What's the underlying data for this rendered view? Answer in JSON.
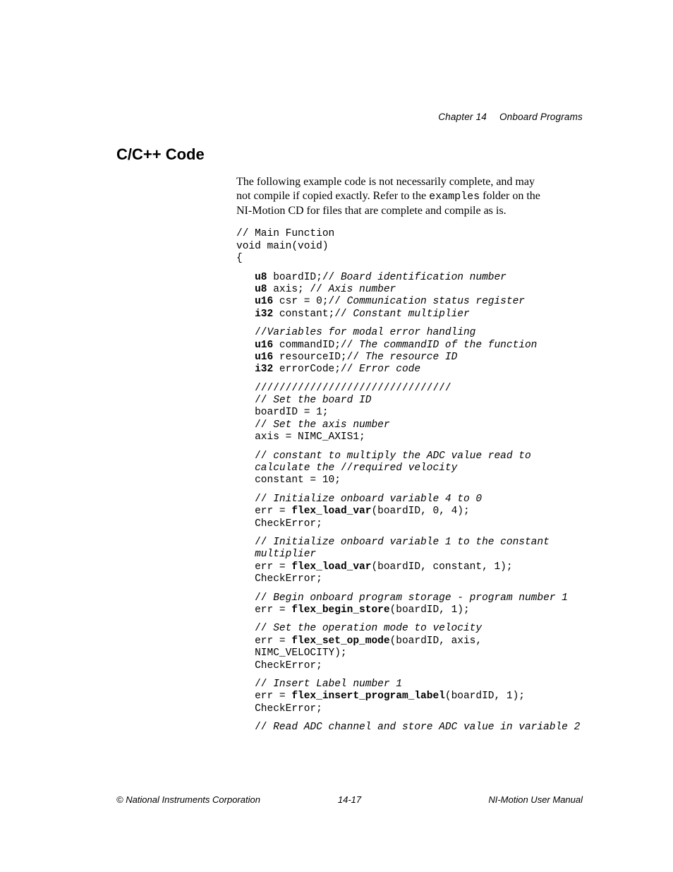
{
  "header": {
    "chapter_label": "Chapter 14",
    "chapter_title": "Onboard Programs"
  },
  "heading": "C/C++ Code",
  "intro": {
    "line1a": "The following example code is not necessarily complete, and may ",
    "line2a": "not compile if copied exactly. Refer to the ",
    "line2_code": "examples",
    "line2b": " folder on the ",
    "line3": "NI-Motion CD for files that are complete and compile as is."
  },
  "code": {
    "p1_l1": "// Main Function",
    "p1_l2": "void main(void)",
    "p1_l3": "{",
    "p2_prefix": "   ",
    "p2_l1_kw": "u8",
    "p2_l1_rest": " boardID;// ",
    "p2_l1_it": "Board identification number",
    "p2_l2_kw": "u8",
    "p2_l2_rest": " axis; // ",
    "p2_l2_it": "Axis number",
    "p2_l3_kw": "u16",
    "p2_l3_rest": " csr = 0;// ",
    "p2_l3_it": "Communication status register",
    "p2_l4_kw": "i32",
    "p2_l4_rest": " constant;// ",
    "p2_l4_it": "Constant multiplier",
    "p3_l1_a": "   //",
    "p3_l1_it": "Variables for modal error handling",
    "p3_l2_kw": "u16",
    "p3_l2_rest": " commandID;// ",
    "p3_l2_it": "The commandID of the function",
    "p3_l3_kw": "u16",
    "p3_l3_rest": " resourceID;// ",
    "p3_l3_it": "The resource ID",
    "p3_l4_kw": "i32",
    "p3_l4_rest": " errorCode;// ",
    "p3_l4_it": "Error code",
    "p4_l1": "   ////////////////////////////////",
    "p4_l2_a": "   // ",
    "p4_l2_it": "Set the board ID",
    "p4_l3": "   boardID = 1;",
    "p4_l4_a": "   // ",
    "p4_l4_it": "Set the axis number",
    "p4_l5": "   axis = NIMC_AXIS1;",
    "p5_l1_a": "   // ",
    "p5_l1_it": "constant to multiply the ADC value read to ",
    "p5_l2_it_a": "calculate the ",
    "p5_l2_mid": "//",
    "p5_l2_it_b": "required velocity",
    "p5_l3": "   constant = 10;",
    "p6_l1_a": "   // ",
    "p6_l1_it": "Initialize onboard variable 4 to 0",
    "p6_l2_a": "   err = ",
    "p6_l2_fn": "flex_load_var",
    "p6_l2_b": "(boardID, 0, 4);",
    "p6_l3": "   CheckError;",
    "p7_l1_a": "   // ",
    "p7_l1_it": "Initialize onboard variable 1 to the constant ",
    "p7_l2_it": "multiplier",
    "p7_l3_a": "   err = ",
    "p7_l3_fn": "flex_load_var",
    "p7_l3_b": "(boardID, constant, 1);",
    "p7_l4": "   CheckError;",
    "p8_l1_a": "   // ",
    "p8_l1_it": "Begin onboard program storage - program number 1",
    "p8_l2_a": "   err = ",
    "p8_l2_fn": "flex_begin_store",
    "p8_l2_b": "(boardID, 1);",
    "p9_l1_a": "   // ",
    "p9_l1_it": "Set the operation mode to velocity",
    "p9_l2_a": "   err = ",
    "p9_l2_fn": "flex_set_op_mode",
    "p9_l2_b": "(boardID, axis, ",
    "p9_l3": "   NIMC_VELOCITY);",
    "p9_l4": "   CheckError;",
    "p10_l1_a": "   // ",
    "p10_l1_it": "Insert Label number 1",
    "p10_l2_a": "   err = ",
    "p10_l2_fn": "flex_insert_program_label",
    "p10_l2_b": "(boardID, 1);",
    "p10_l3": "   CheckError;",
    "p11_l1_a": "   // ",
    "p11_l1_it": "Read ADC channel and store ADC value in variable 2"
  },
  "footer": {
    "left": "© National Instruments Corporation",
    "center": "14-17",
    "right": "NI-Motion User Manual"
  }
}
